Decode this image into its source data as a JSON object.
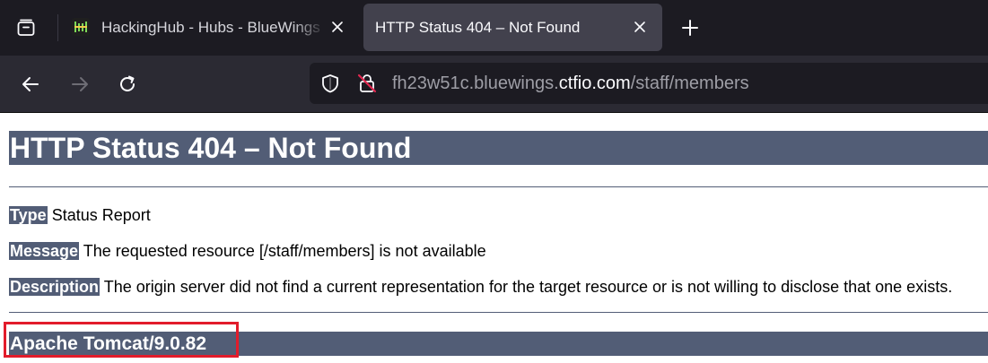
{
  "browser": {
    "tabs": [
      {
        "title": "HackingHub - Hubs - BlueWings"
      },
      {
        "title": "HTTP Status 404 – Not Found"
      }
    ],
    "url": {
      "prefix": "fh23w51c.bluewings.",
      "domain": "ctfio.com",
      "path": "/staff/members"
    },
    "colors": {
      "chrome_dark": "#1c1b22",
      "toolbar": "#2b2a33",
      "active_tab": "#42414d"
    }
  },
  "page": {
    "heading": "HTTP Status 404 – Not Found",
    "rows": [
      {
        "label": "Type",
        "text": " Status Report"
      },
      {
        "label": "Message",
        "text": " The requested resource [/staff/members] is not available"
      },
      {
        "label": "Description",
        "text": " The origin server did not find a current representation for the target resource or is not willing to disclose that one exists."
      }
    ],
    "server": "Apache Tomcat/9.0.82",
    "colors": {
      "bar": "#525d76",
      "highlight_box": "#e21c2b"
    }
  }
}
